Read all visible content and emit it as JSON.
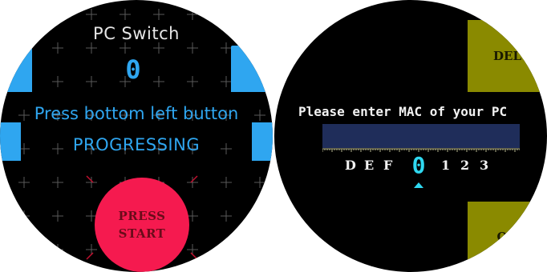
{
  "left_screen": {
    "title": "PC Switch",
    "state_digit": "0",
    "instruction": "Press bottom left button",
    "status": "PROGRESSING",
    "press_button": {
      "line1": "PRESS",
      "line2": "START"
    },
    "colors": {
      "accent": "#2fa6f0",
      "button": "#f51a4f"
    }
  },
  "right_screen": {
    "del_label": "DEL",
    "ok_label": "OK",
    "prompt": "Please enter MAC of your PC",
    "mac_value": "",
    "chars_before": [
      "D",
      "E",
      "F"
    ],
    "selected_char": "0",
    "chars_after": [
      "1",
      "2",
      "3"
    ],
    "colors": {
      "field": "#1f2d5a",
      "corner": "#8a8a00",
      "selected": "#2fd8f0"
    }
  }
}
